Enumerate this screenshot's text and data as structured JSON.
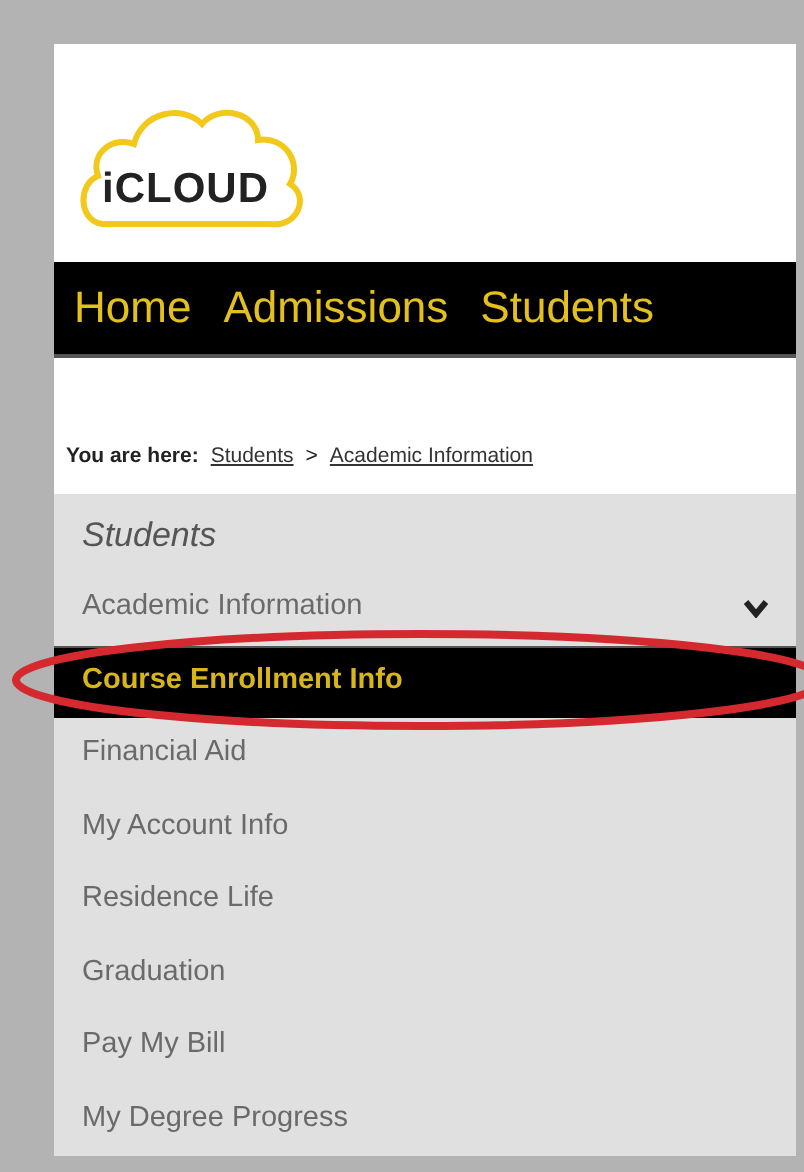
{
  "logo": {
    "text": "iCLOUD"
  },
  "nav": [
    {
      "label": "Home"
    },
    {
      "label": "Admissions"
    },
    {
      "label": "Students"
    }
  ],
  "breadcrumb": {
    "label": "You are here:",
    "links": [
      "Students",
      "Academic Information"
    ],
    "separator": ">"
  },
  "sidebar": {
    "title": "Students",
    "items": [
      {
        "label": "Academic Information",
        "selected": false,
        "expanded": true
      },
      {
        "label": "Course Enrollment Info",
        "selected": true,
        "expanded": false
      },
      {
        "label": "Financial Aid",
        "selected": false,
        "expanded": false
      },
      {
        "label": "My Account Info",
        "selected": false,
        "expanded": false
      },
      {
        "label": "Residence Life",
        "selected": false,
        "expanded": false
      },
      {
        "label": "Graduation",
        "selected": false,
        "expanded": false
      },
      {
        "label": "Pay My Bill",
        "selected": false,
        "expanded": false
      },
      {
        "label": "My Degree Progress",
        "selected": false,
        "expanded": false
      }
    ]
  },
  "annotation": {
    "kind": "ellipse"
  }
}
